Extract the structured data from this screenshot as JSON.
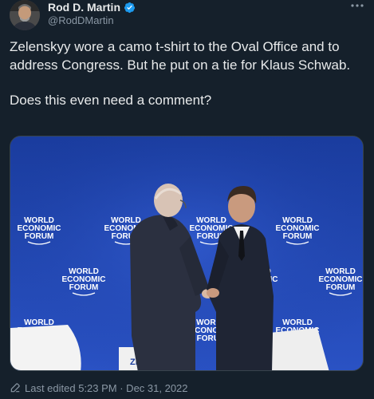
{
  "author": {
    "display_name": "Rod D. Martin",
    "handle": "@RodDMartin",
    "verified": true
  },
  "more_icon": "more-horizontal-icon",
  "tweet": {
    "paragraphs": [
      "Zelenskyy wore a camo t-shirt to the Oval Office and to address Congress. But he put on a tie for Klaus Schwab.",
      "Does this even need a comment?"
    ]
  },
  "media": {
    "backdrop_logo_lines": [
      "WORLD",
      "ECONOMIC",
      "FORUM"
    ],
    "podium_text": "ZE"
  },
  "footer": {
    "edited_label": "Last edited 5:23 PM · Dec 31, 2022",
    "edit_icon": "pencil-icon"
  },
  "colors": {
    "background": "#15202b",
    "text_primary": "#e7e9ea",
    "text_secondary": "#8b98a5",
    "verified_badge": "#1d9bf0",
    "backdrop_blue": "#1c40a8"
  }
}
